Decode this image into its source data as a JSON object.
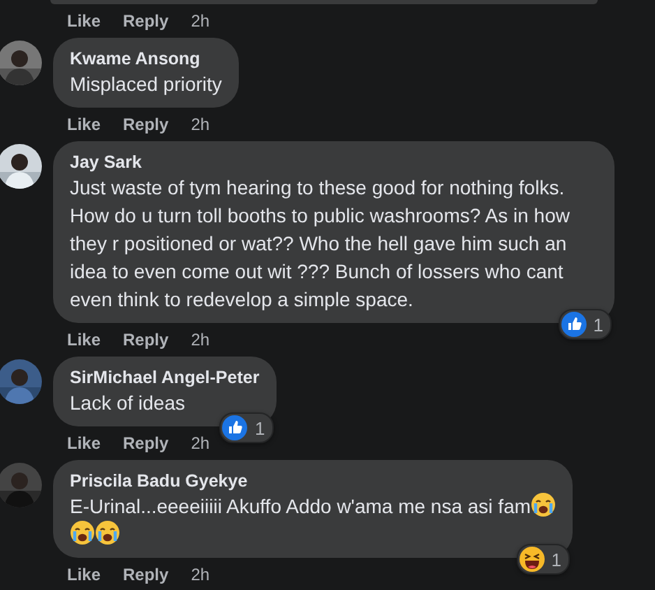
{
  "previous_comment": {
    "actions": {
      "like": "Like",
      "reply": "Reply",
      "time": "2h"
    }
  },
  "comments": [
    {
      "author": "Kwame Ansong",
      "body": [
        {
          "kind": "text",
          "text": "Misplaced priority"
        }
      ],
      "actions": {
        "like": "Like",
        "reply": "Reply",
        "time": "2h"
      }
    },
    {
      "author": "Jay Sark",
      "body": [
        {
          "kind": "text",
          "text": "Just waste of tym hearing to these good for nothing folks. How do u turn toll booths to public washrooms? As in how they r positioned or wat?? Who the hell gave him such an idea to even come out wit ??? Bunch of lossers who cant even think to redevelop a simple space."
        }
      ],
      "reaction": {
        "kind": "like",
        "count": "1"
      },
      "actions": {
        "like": "Like",
        "reply": "Reply",
        "time": "2h"
      }
    },
    {
      "author": "SirMichael Angel-Peter",
      "body": [
        {
          "kind": "text",
          "text": "Lack of ideas"
        }
      ],
      "reaction": {
        "kind": "like",
        "count": "1"
      },
      "actions": {
        "like": "Like",
        "reply": "Reply",
        "time": "2h"
      }
    },
    {
      "author": "Priscila Badu Gyekye",
      "body": [
        {
          "kind": "text",
          "text": "E-Urinal...eeeeiiiii Akuffo Addo w'ama me nsa asi fam"
        },
        {
          "kind": "crying"
        },
        {
          "kind": "break"
        },
        {
          "kind": "crying"
        },
        {
          "kind": "crying"
        }
      ],
      "reaction": {
        "kind": "haha",
        "count": "1"
      },
      "actions": {
        "like": "Like",
        "reply": "Reply",
        "time": "2h"
      }
    }
  ]
}
